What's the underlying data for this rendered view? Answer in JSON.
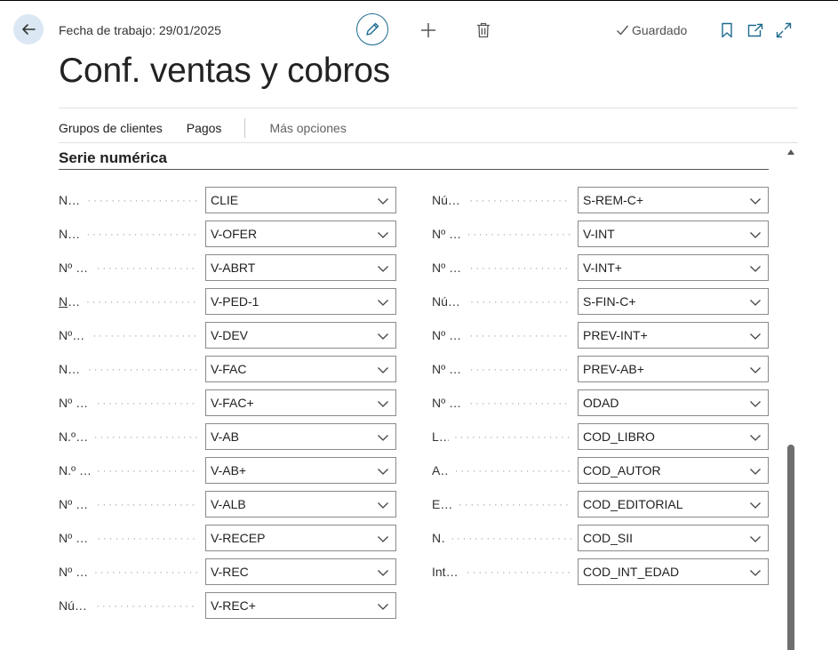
{
  "header": {
    "work_date": "Fecha de trabajo: 29/01/2025",
    "saved_label": "Guardado",
    "page_title": "Conf. ventas y cobros"
  },
  "actions": {
    "customer_groups": "Grupos de clientes",
    "payments": "Pagos",
    "more_options": "Más opciones"
  },
  "section": {
    "title": "Serie numérica"
  },
  "left_fields": [
    {
      "label": "Nº serie cliente",
      "value": "CLIE"
    },
    {
      "label": "Nº serie oferta",
      "value": "V-OFER"
    },
    {
      "label": "Nº serie pedido abier...",
      "value": "V-ABRT"
    },
    {
      "label": "Nº ser. pedido",
      "value": "V-PED-1"
    },
    {
      "label": "Nº serie devolución",
      "value": "V-DEV"
    },
    {
      "label": "Nº serie factura",
      "value": "V-FAC"
    },
    {
      "label": "Nº serie fact. registra...",
      "value": "V-FAC+"
    },
    {
      "label": "N.º serie nota abono",
      "value": "V-AB"
    },
    {
      "label": "N.º serie nota abono ...",
      "value": "V-AB+"
    },
    {
      "label": "Nº serie alb. venta re...",
      "value": "V-ALB"
    },
    {
      "label": "Nº serie recep. devol....",
      "value": "V-RECEP"
    },
    {
      "label": "Nº serie recordatorio",
      "value": "V-REC"
    },
    {
      "label": "Números recordatori...",
      "value": "V-REC+"
    }
  ],
  "right_fields": [
    {
      "label": "Números recordatori...",
      "value": "S-REM-C+"
    },
    {
      "label": "Nº serie doc. interés",
      "value": "V-INT"
    },
    {
      "label": "Nº serie doc. interés ...",
      "value": "V-INT+"
    },
    {
      "label": "Números ser. doc. int...",
      "value": "S-FIN-C+"
    },
    {
      "label": "Nº fact. prepago regi...",
      "value": "PREV-INT+"
    },
    {
      "label": "Nº abono prepago re...",
      "value": "PREV-AB+"
    },
    {
      "label": "Nº de órdenes de do...",
      "value": "ODAD"
    },
    {
      "label": "Libro Nos.",
      "value": "COD_LIBRO"
    },
    {
      "label": "Autor Nos.",
      "value": "COD_AUTOR"
    },
    {
      "label": "Editorial Nos.",
      "value": "COD_EDITORIAL"
    },
    {
      "label": "Nos. SII",
      "value": "COD_SII"
    },
    {
      "label": "Intervalo Edad Nos.",
      "value": "COD_INT_EDAD"
    }
  ],
  "icons": {
    "back": "arrow-left-icon",
    "edit": "pencil-icon",
    "new": "plus-icon",
    "delete": "trash-icon",
    "saved": "checkmark-icon",
    "bookmark": "bookmark-icon",
    "open_new_window": "open-in-new-window-icon",
    "expand": "expand-icon",
    "dropdown": "chevron-down-icon"
  },
  "colors": {
    "accent": "#1d6a8f",
    "back_button_bg": "#dbe8f3"
  }
}
